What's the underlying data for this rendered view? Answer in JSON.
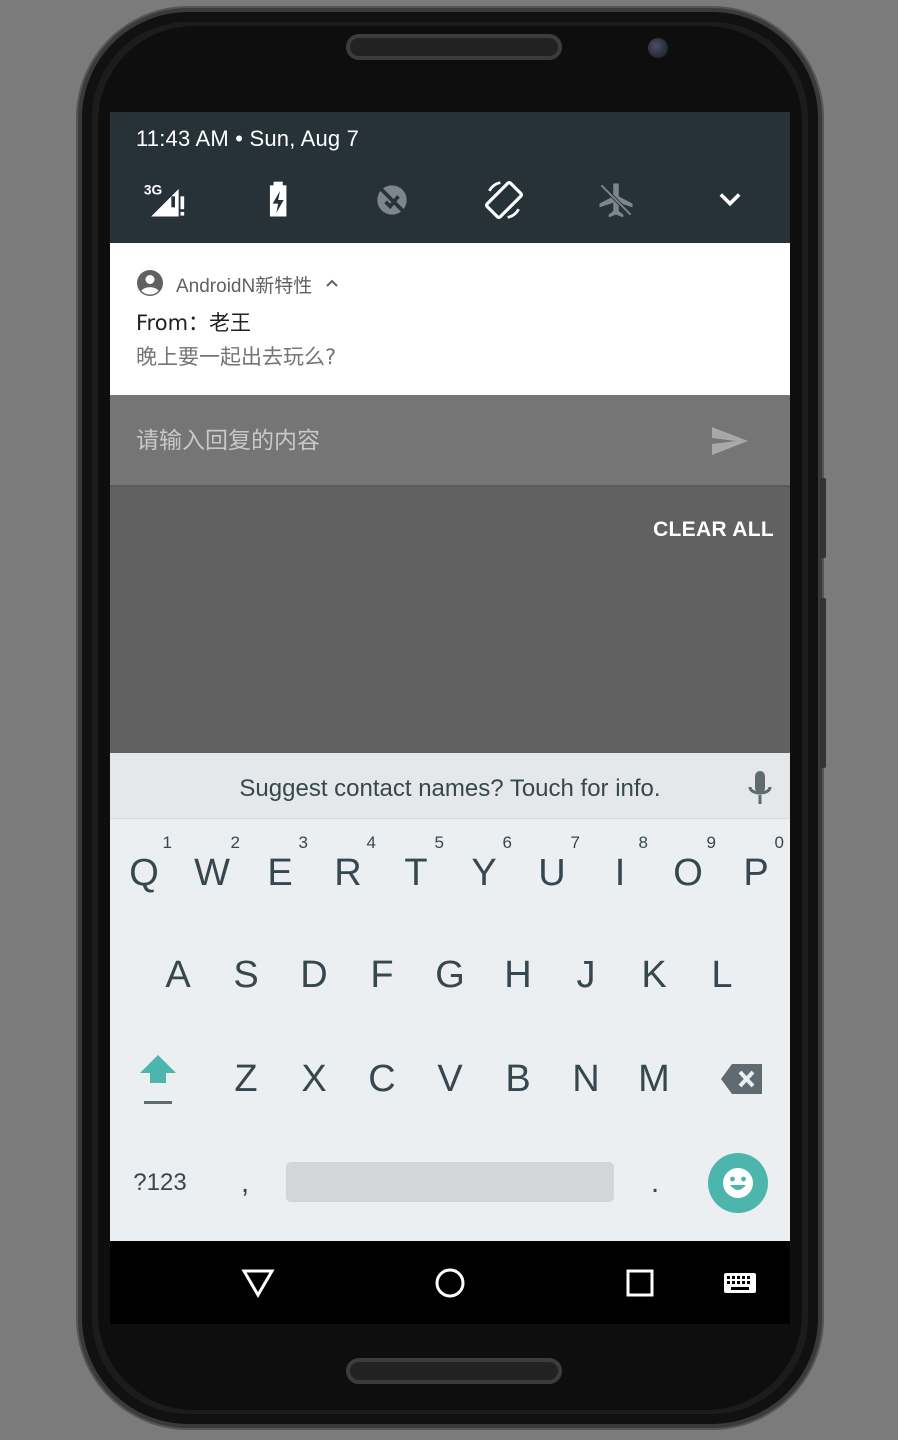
{
  "status": {
    "time_date": "11:43 AM • Sun, Aug 7",
    "network_label": "3G"
  },
  "quick_settings": {
    "icons": [
      "signal-3g-icon",
      "battery-charging-icon",
      "data-saver-off-icon",
      "auto-rotate-icon",
      "airplane-mode-icon",
      "chevron-down-icon"
    ]
  },
  "notification": {
    "app_name": "AndroidN新特性",
    "title": "From：老王",
    "text": "晚上要一起出去玩么?"
  },
  "reply": {
    "placeholder": "请输入回复的内容"
  },
  "shade": {
    "clear_all": "CLEAR ALL"
  },
  "keyboard": {
    "suggestion": "Suggest contact names? Touch for info.",
    "row1": [
      {
        "key": "Q",
        "hint": "1"
      },
      {
        "key": "W",
        "hint": "2"
      },
      {
        "key": "E",
        "hint": "3"
      },
      {
        "key": "R",
        "hint": "4"
      },
      {
        "key": "T",
        "hint": "5"
      },
      {
        "key": "Y",
        "hint": "6"
      },
      {
        "key": "U",
        "hint": "7"
      },
      {
        "key": "I",
        "hint": "8"
      },
      {
        "key": "O",
        "hint": "9"
      },
      {
        "key": "P",
        "hint": "0"
      }
    ],
    "row2": [
      "A",
      "S",
      "D",
      "F",
      "G",
      "H",
      "J",
      "K",
      "L"
    ],
    "row3": [
      "Z",
      "X",
      "C",
      "V",
      "B",
      "N",
      "M"
    ],
    "symbols_label": "?123",
    "comma": ",",
    "period": ".",
    "accent_color": "#4db6ac"
  },
  "colors": {
    "status_bar": "#263238",
    "shade_background": "#616161",
    "reply_bar": "#757575",
    "keyboard_background": "#eceff1"
  }
}
